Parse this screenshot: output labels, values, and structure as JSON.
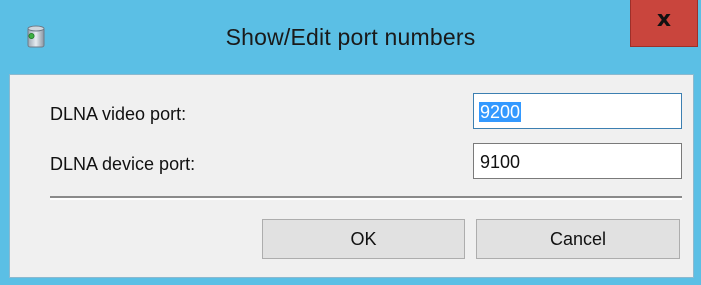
{
  "window": {
    "title": "Show/Edit port numbers",
    "close_glyph": "x"
  },
  "fields": {
    "video_port": {
      "label": "DLNA video port:",
      "value": "9200"
    },
    "device_port": {
      "label": "DLNA device port:",
      "value": "9100"
    }
  },
  "buttons": {
    "ok": "OK",
    "cancel": "Cancel"
  },
  "icons": {
    "app": "app-icon",
    "close": "close-icon"
  },
  "colors": {
    "titlebar": "#5bbfe5",
    "close_button": "#c9453d",
    "dialog_body": "#f0f0f0",
    "selection": "#3399ff"
  }
}
